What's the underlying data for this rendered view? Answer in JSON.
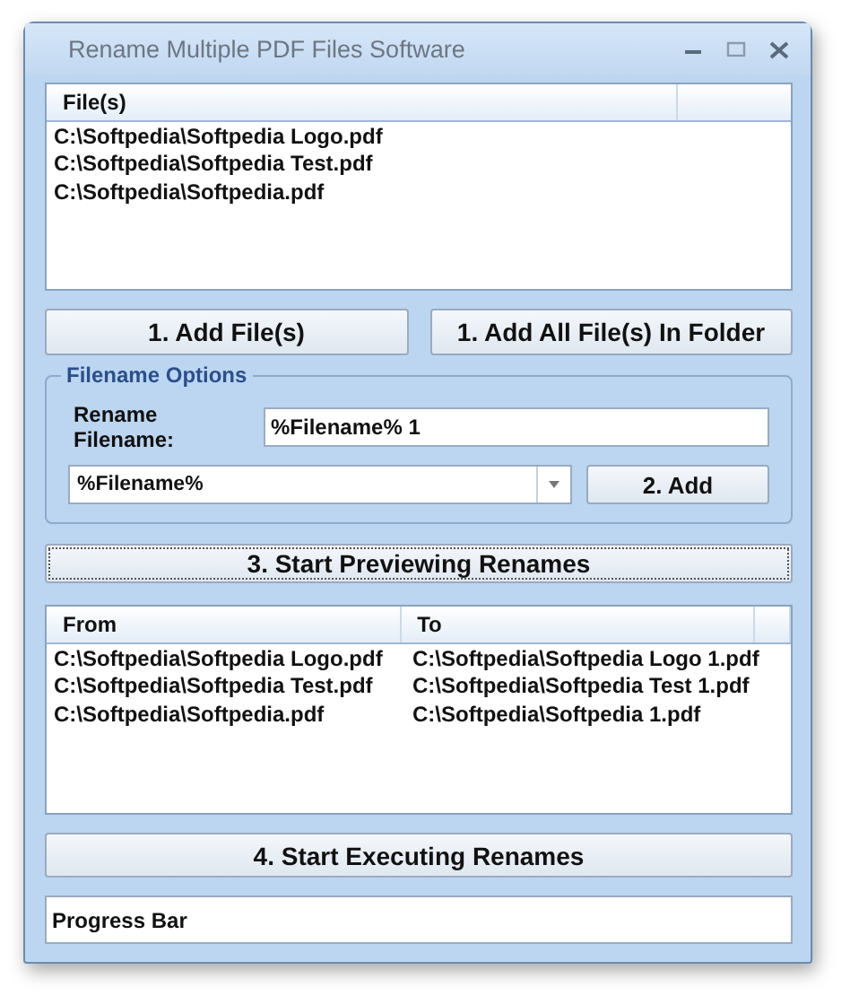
{
  "window": {
    "title": "Rename Multiple PDF Files Software"
  },
  "files_list": {
    "columns": [
      "File(s)"
    ],
    "rows": [
      "C:\\Softpedia\\Softpedia Logo.pdf",
      "C:\\Softpedia\\Softpedia Test.pdf",
      "C:\\Softpedia\\Softpedia.pdf"
    ]
  },
  "add_buttons": [
    "1. Add File(s)",
    "1. Add All File(s) In Folder"
  ],
  "filename_options": {
    "title": "Filename Options",
    "rename_label": "Rename Filename:",
    "rename_value": "%Filename% 1",
    "dropdown_value": "%Filename%",
    "add_button": "2. Add"
  },
  "preview_button": {
    "label": "3. Start Previewing Renames",
    "focused": true
  },
  "preview_list": {
    "columns": [
      "From",
      "To"
    ],
    "rows": [
      [
        "C:\\Softpedia\\Softpedia Logo.pdf",
        "C:\\Softpedia\\Softpedia Logo 1.pdf"
      ],
      [
        "C:\\Softpedia\\Softpedia Test.pdf",
        "C:\\Softpedia\\Softpedia Test 1.pdf"
      ],
      [
        "C:\\Softpedia\\Softpedia.pdf",
        "C:\\Softpedia\\Softpedia 1.pdf"
      ]
    ]
  },
  "execute_button": {
    "label": "4. Start Executing Renames"
  },
  "progress_bar": {
    "label": "Progress Bar"
  }
}
